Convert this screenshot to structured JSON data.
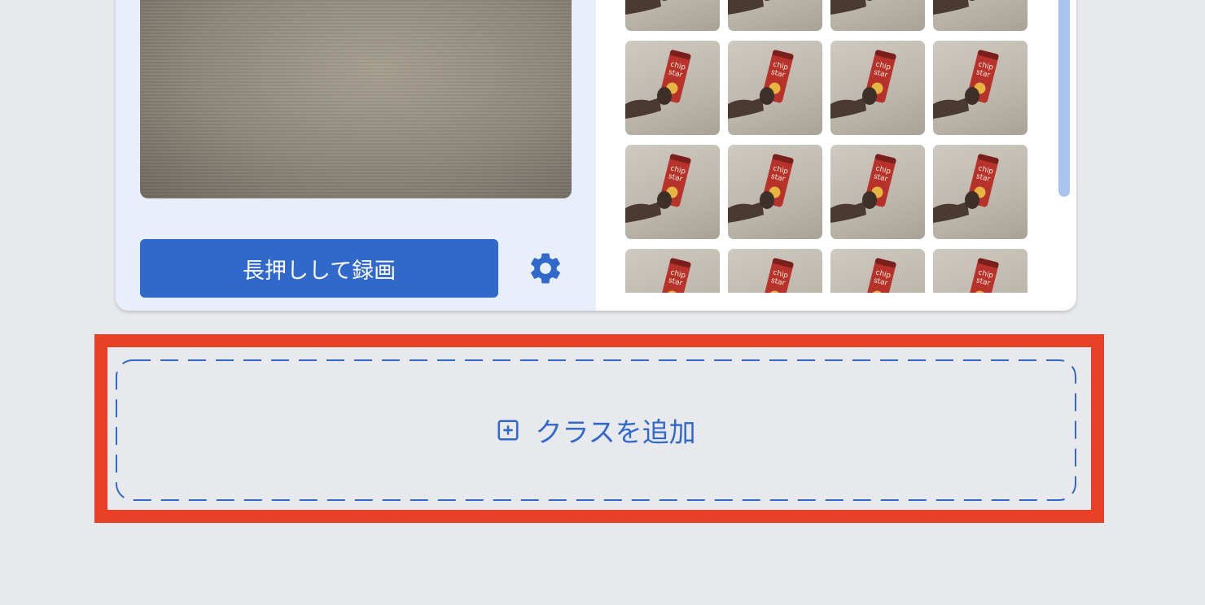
{
  "class_card": {
    "record_button_label": "長押しして録画",
    "settings_icon": "gear-icon",
    "sample_count_visible": 16
  },
  "add_class": {
    "label": "クラスを追加",
    "icon": "plus-box-icon"
  },
  "colors": {
    "accent": "#3068cc",
    "left_panel_bg": "#e8effb",
    "page_bg": "#e8e9ed",
    "highlight": "#e94027",
    "scrollbar": "#aac2ee"
  }
}
